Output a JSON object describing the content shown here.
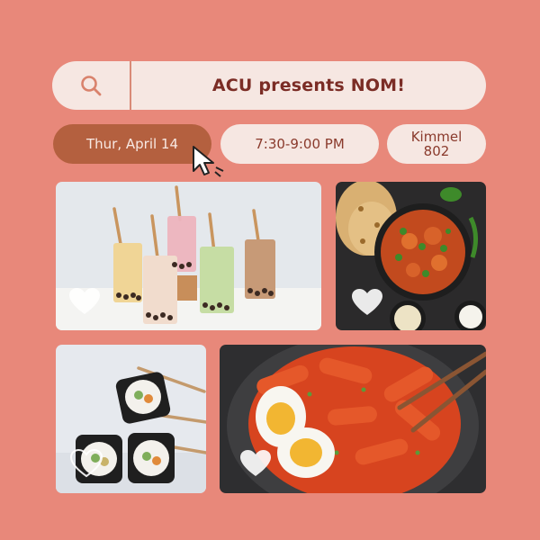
{
  "search": {
    "icon": "search-icon",
    "title": "ACU presents NOM!"
  },
  "event": {
    "date": "Thur, April 14",
    "time": "7:30-9:00 PM",
    "location_line1": "Kimmel",
    "location_line2": "802"
  },
  "cards": [
    {
      "name": "bubble-tea",
      "icon": "heart-icon"
    },
    {
      "name": "curry-naan",
      "icon": "heart-icon"
    },
    {
      "name": "sushi-rolls",
      "icon": "heart-icon"
    },
    {
      "name": "tteokbokki",
      "icon": "heart-icon"
    }
  ],
  "colors": {
    "background": "#E8887A",
    "pill_light": "#F6E7E2",
    "pill_dark": "#B4603F",
    "title_text": "#7B2C25"
  }
}
